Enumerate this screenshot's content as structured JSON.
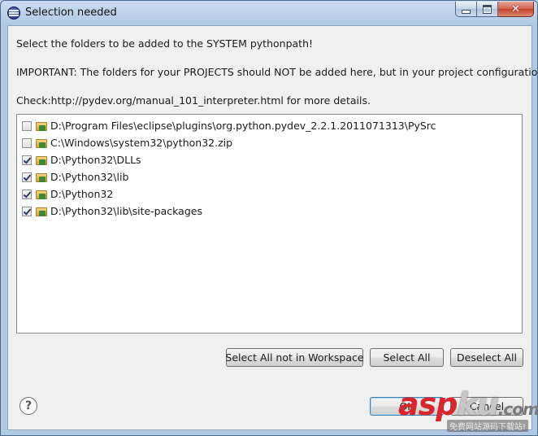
{
  "window": {
    "title": "Selection needed",
    "controls": {
      "close": "✕"
    }
  },
  "messages": {
    "line1": "Select the folders to be added to the SYSTEM pythonpath!",
    "line2": "IMPORTANT: The folders for your PROJECTS should NOT be added here, but in your project configuration.",
    "line3": "Check:http://pydev.org/manual_101_interpreter.html for more details."
  },
  "folders": [
    {
      "path": "D:\\Program Files\\eclipse\\plugins\\org.python.pydev_2.2.1.2011071313\\PySrc",
      "checked": false
    },
    {
      "path": "C:\\Windows\\system32\\python32.zip",
      "checked": false
    },
    {
      "path": "D:\\Python32\\DLLs",
      "checked": true
    },
    {
      "path": "D:\\Python32\\lib",
      "checked": true
    },
    {
      "path": "D:\\Python32",
      "checked": true
    },
    {
      "path": "D:\\Python32\\lib\\site-packages",
      "checked": true
    }
  ],
  "buttons": {
    "select_not_in_workspace": "Select All not in Workspace",
    "select_all": "Select All",
    "deselect_all": "Deselect All",
    "ok": "OK",
    "cancel": "Cancel"
  },
  "help": {
    "glyph": "?"
  },
  "watermark": {
    "brand_a": "asp",
    "brand_b": "ku",
    "brand_c": ".com",
    "tagline": "免费网站源码下载站!"
  },
  "icons": {
    "app": "eclipse-icon",
    "folder": "folder-icon",
    "help": "help-icon"
  }
}
